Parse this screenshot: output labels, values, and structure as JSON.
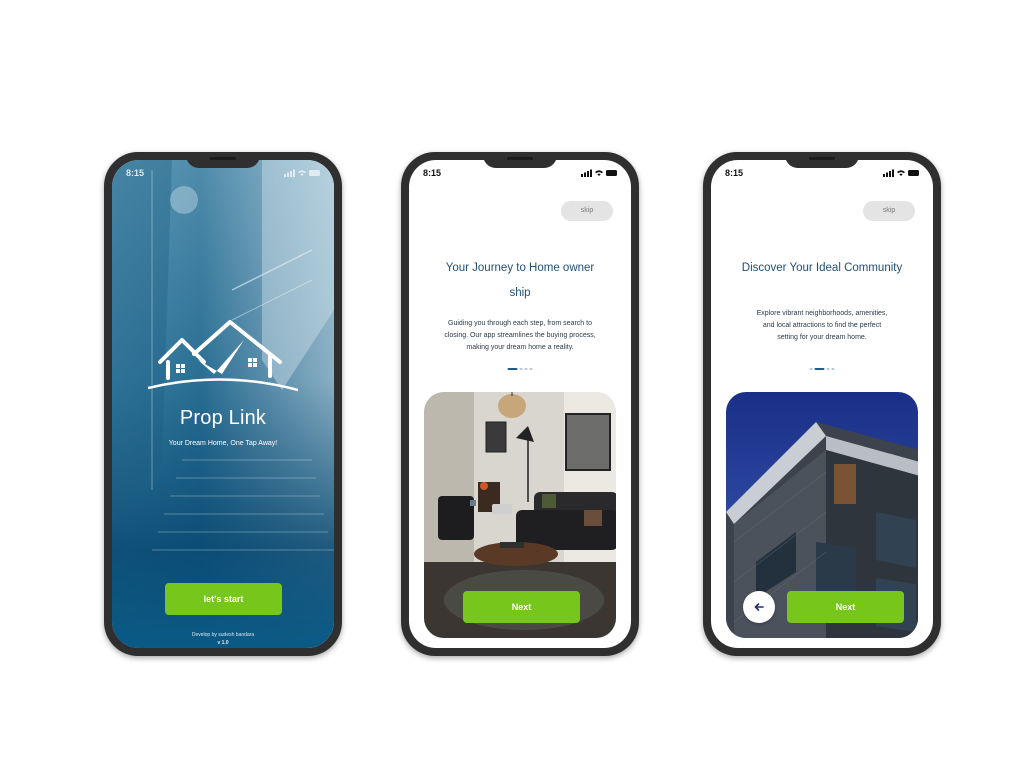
{
  "screens": [
    {
      "status_time": "8:15",
      "app_name": "Prop Link",
      "tagline": "Your Dream Home, One Tap Away!",
      "start_button": "let's start",
      "credit": "Develop by sudesh bandara",
      "version": "v 1.0"
    },
    {
      "status_time": "8:15",
      "skip_label": "skip",
      "title_line1": "Your Journey to Home owner",
      "title_line2": "ship",
      "desc_line1": "Guiding you through each step, from search to",
      "desc_line2": "closing. Our app streamlines the buying process,",
      "desc_line3": "making your dream home a reality.",
      "page_indicator": {
        "total": 4,
        "active": 1
      },
      "next_button": "Next"
    },
    {
      "status_time": "8:15",
      "skip_label": "skip",
      "title": "Discover Your Ideal Community",
      "desc_line1": "Explore vibrant neighborhoods, amenities,",
      "desc_line2": "and local attractions to find the perfect",
      "desc_line3": "setting for your dream home.",
      "page_indicator": {
        "total": 4,
        "active": 2
      },
      "next_button": "Next",
      "back_icon": "arrow-left-icon"
    }
  ],
  "colors": {
    "accent_green": "#76c61c",
    "title_blue": "#1f4f78",
    "splash_blue": "#0a5a86"
  }
}
